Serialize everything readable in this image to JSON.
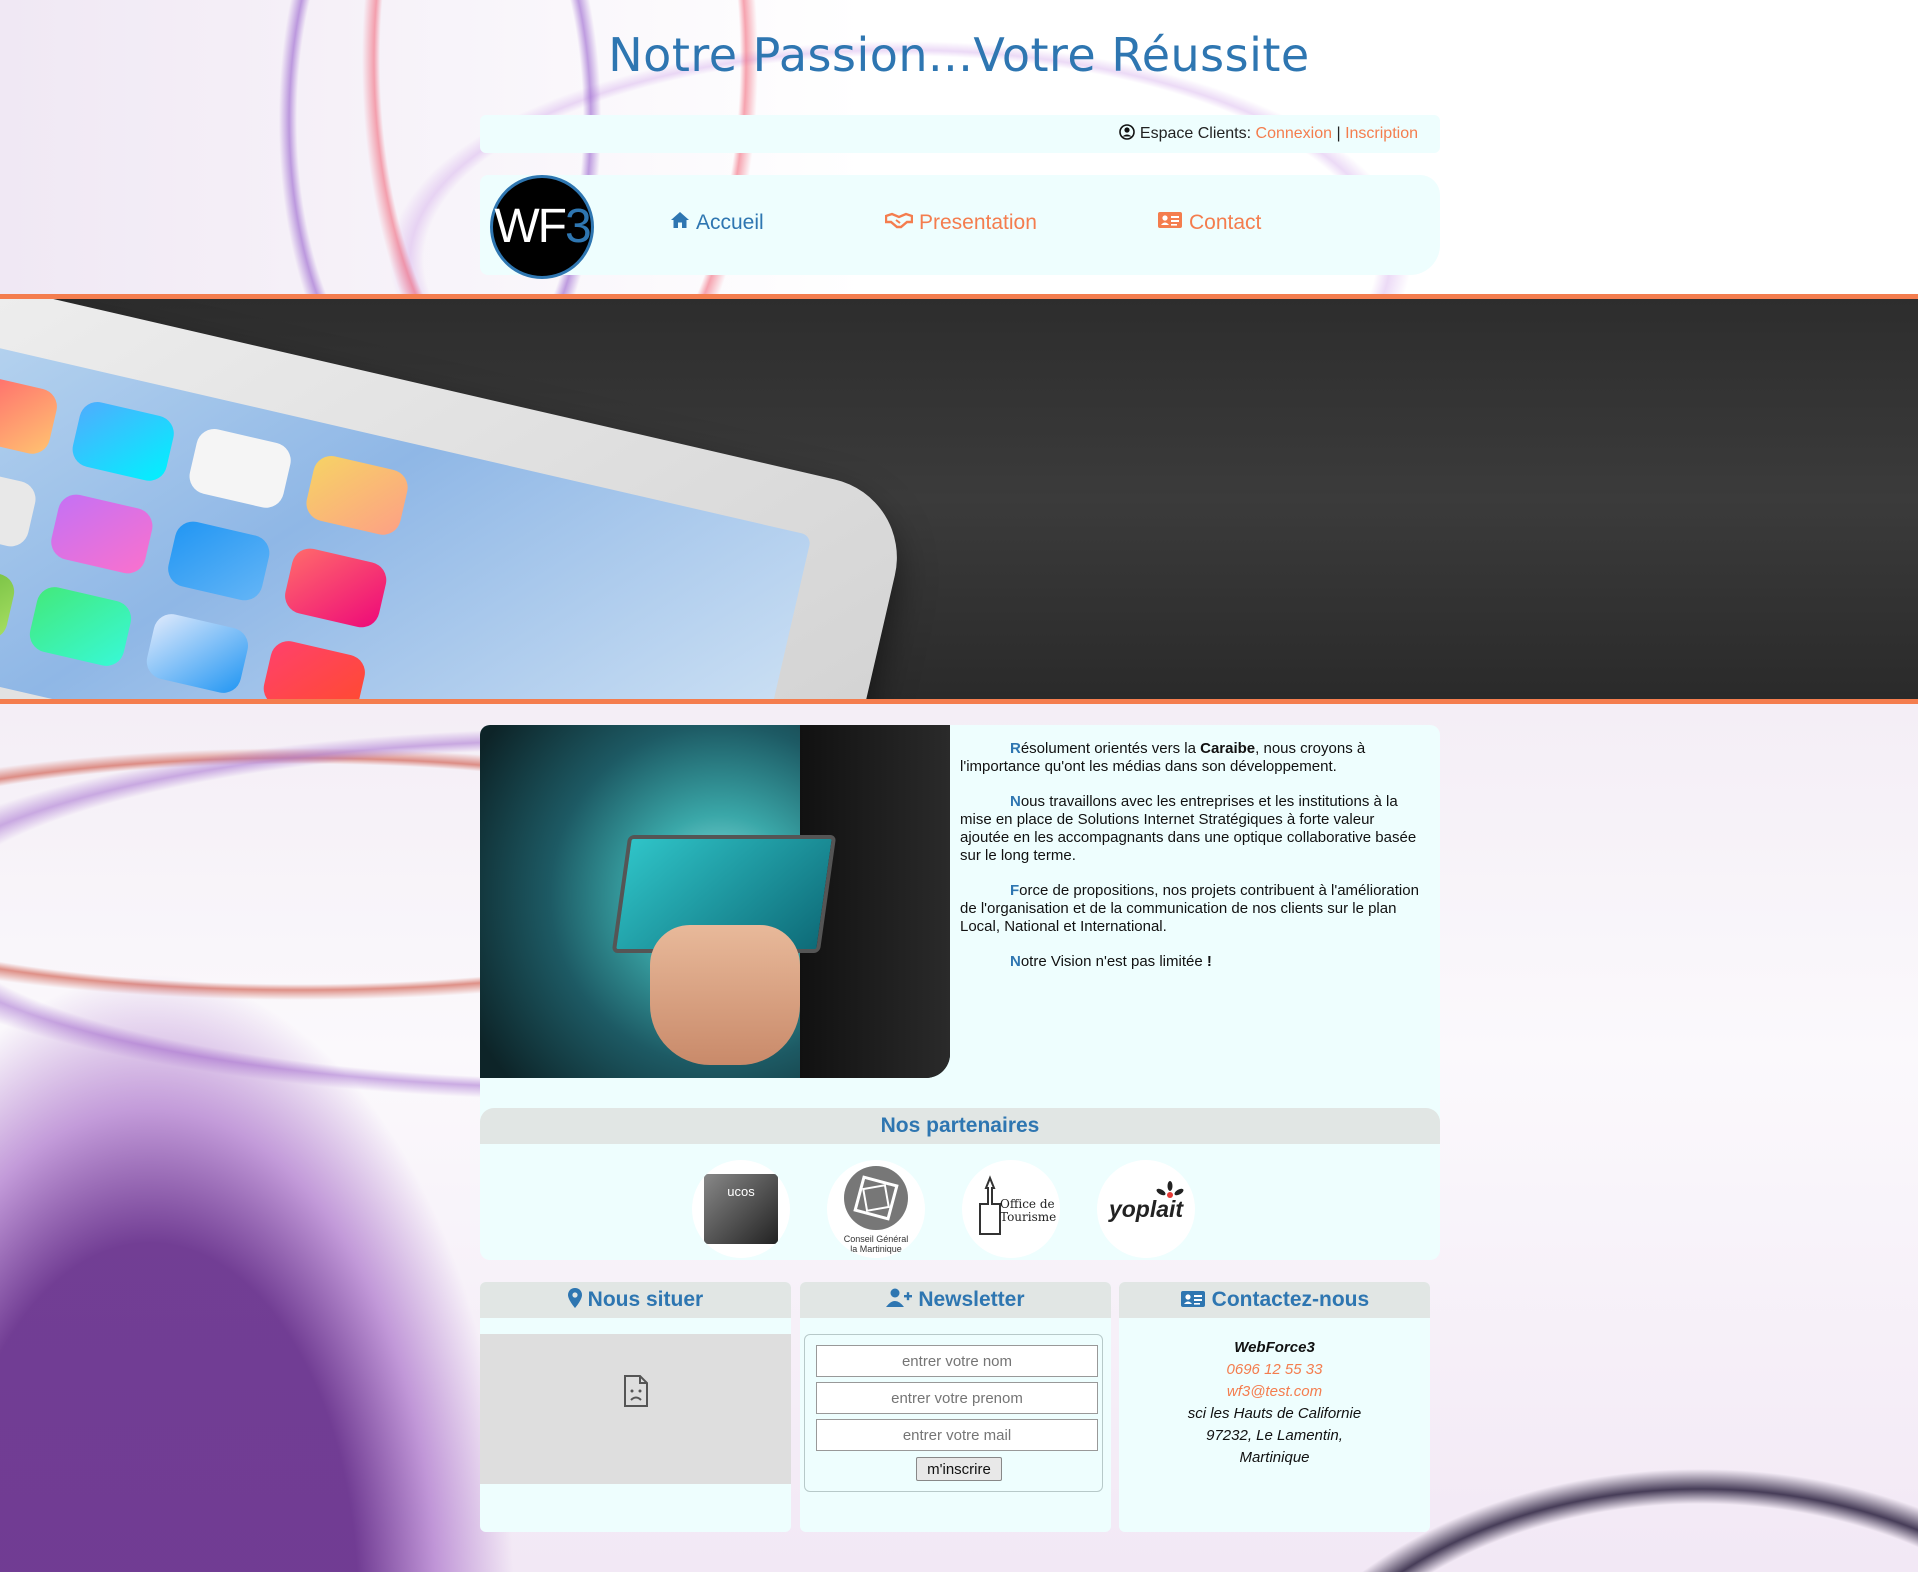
{
  "header": {
    "title": "Notre Passion...Votre Réussite"
  },
  "client_bar": {
    "label": "Espace Clients:",
    "login": "Connexion",
    "separator": "|",
    "register": "Inscription"
  },
  "nav": {
    "logo_text_a": "WF",
    "logo_text_b": "3",
    "items": [
      {
        "label": "Accueil",
        "icon": "home-icon",
        "color": "#2e76b1"
      },
      {
        "label": "Presentation",
        "icon": "handshake-icon",
        "color": "#f47d4e"
      },
      {
        "label": "Contact",
        "icon": "address-card-icon",
        "color": "#f47d4e"
      }
    ]
  },
  "about": {
    "p1_cap": "R",
    "p1_a": "ésolument orientés vers la ",
    "p1_bold": "Caraibe",
    "p1_b": ", nous croyons à l'importance qu'ont les médias dans son développement.",
    "p2_cap": "N",
    "p2": "ous travaillons avec les entreprises et les institutions à la mise en place de Solutions Internet Stratégiques à forte valeur ajoutée en les accompagnants dans une optique collaborative basée sur le long terme.",
    "p3_cap": "F",
    "p3": "orce de propositions, nos projets contribuent à l'amélioration de l'organisation et de la communication de nos clients sur le plan Local, National et International.",
    "p4_cap": "N",
    "p4": "otre Vision n'est pas limitée",
    "p4_bold": " !"
  },
  "partners": {
    "title": "Nos partenaires",
    "logos": [
      {
        "name": "ucos",
        "text": "ucos"
      },
      {
        "name": "conseil-general",
        "text_a": "Conseil Général",
        "text_b": "la Martinique"
      },
      {
        "name": "office-tourisme",
        "text_a": "Office de",
        "text_b": "Tourisme"
      },
      {
        "name": "yoplait",
        "text": "yoplait"
      }
    ]
  },
  "locate": {
    "title": "Nous situer"
  },
  "newsletter": {
    "title": "Newsletter",
    "name_placeholder": "entrer votre nom",
    "firstname_placeholder": "entrer votre prenom",
    "mail_placeholder": "entrer votre mail",
    "button": "m'inscrire"
  },
  "contact": {
    "title": "Contactez-nous",
    "company": "WebForce3",
    "phone": "0696 12 55 33",
    "email": "wf3@test.com",
    "address1": "sci les Hauts de Californie",
    "address2": "97232, Le Lamentin,",
    "address3": "Martinique"
  },
  "colors": {
    "accent_blue": "#2e76b1",
    "accent_orange": "#f47d4e",
    "panel": "#eefefe"
  }
}
